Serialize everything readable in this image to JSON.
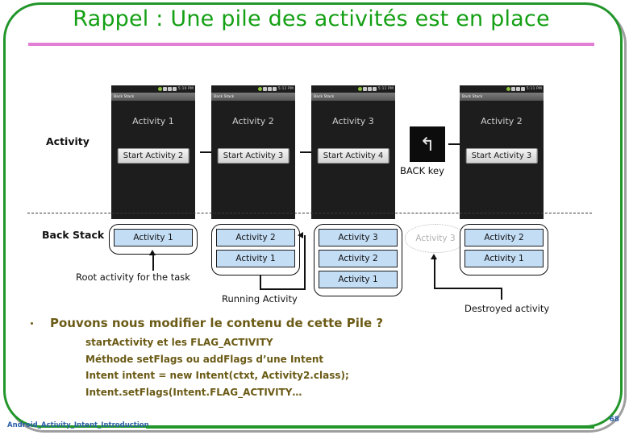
{
  "slide": {
    "title": "Rappel : Une pile des activités est en place",
    "accent_green": "#14a014",
    "accent_pink": "#e27fd4",
    "body_text_color": "#6b5b16",
    "activity_box_color": "#c3ddf5"
  },
  "diagram": {
    "row_labels": {
      "activity": "Activity",
      "back_stack": "Back Stack"
    },
    "phones": [
      {
        "title_bar": "Back Stack",
        "status_time": "5:10 PM",
        "screen_title": "Activity 1",
        "button_label": "Start Activity 2"
      },
      {
        "title_bar": "Back Stack",
        "status_time": "5:11 PM",
        "screen_title": "Activity 2",
        "button_label": "Start Activity 3"
      },
      {
        "title_bar": "Back Stack",
        "status_time": "5:11 PM",
        "screen_title": "Activity 3",
        "button_label": "Start Activity 4"
      },
      {
        "title_bar": "Back Stack",
        "status_time": "5:11 PM",
        "screen_title": "Activity 2",
        "button_label": "Start Activity 3"
      }
    ],
    "back_key": {
      "label": "BACK key",
      "glyph": "↰"
    },
    "stacks": [
      {
        "items": [
          "Activity 1"
        ]
      },
      {
        "items": [
          "Activity 2",
          "Activity 1"
        ]
      },
      {
        "items": [
          "Activity 3",
          "Activity 2",
          "Activity 1"
        ]
      },
      {
        "items": [
          "Activity 2",
          "Activity 1"
        ]
      }
    ],
    "ghost_activity": "Activity 3",
    "captions": {
      "root_activity": "Root activity for the task",
      "running_activity": "Running Activity",
      "destroyed_activity": "Destroyed activity"
    }
  },
  "body": {
    "bullet": "Pouvons nous modifier le contenu de cette Pile ?",
    "sub_lines": [
      "startActivity et les FLAG_ACTIVITY",
      "Méthode setFlags ou addFlags d’une Intent",
      "Intent intent = new Intent(ctxt, Activity2.class);",
      "Intent.setFlags(Intent.FLAG_ACTIVITY…"
    ]
  },
  "footer": {
    "label": "Android_Activity_Intent_Introduction",
    "page_number": "68"
  }
}
